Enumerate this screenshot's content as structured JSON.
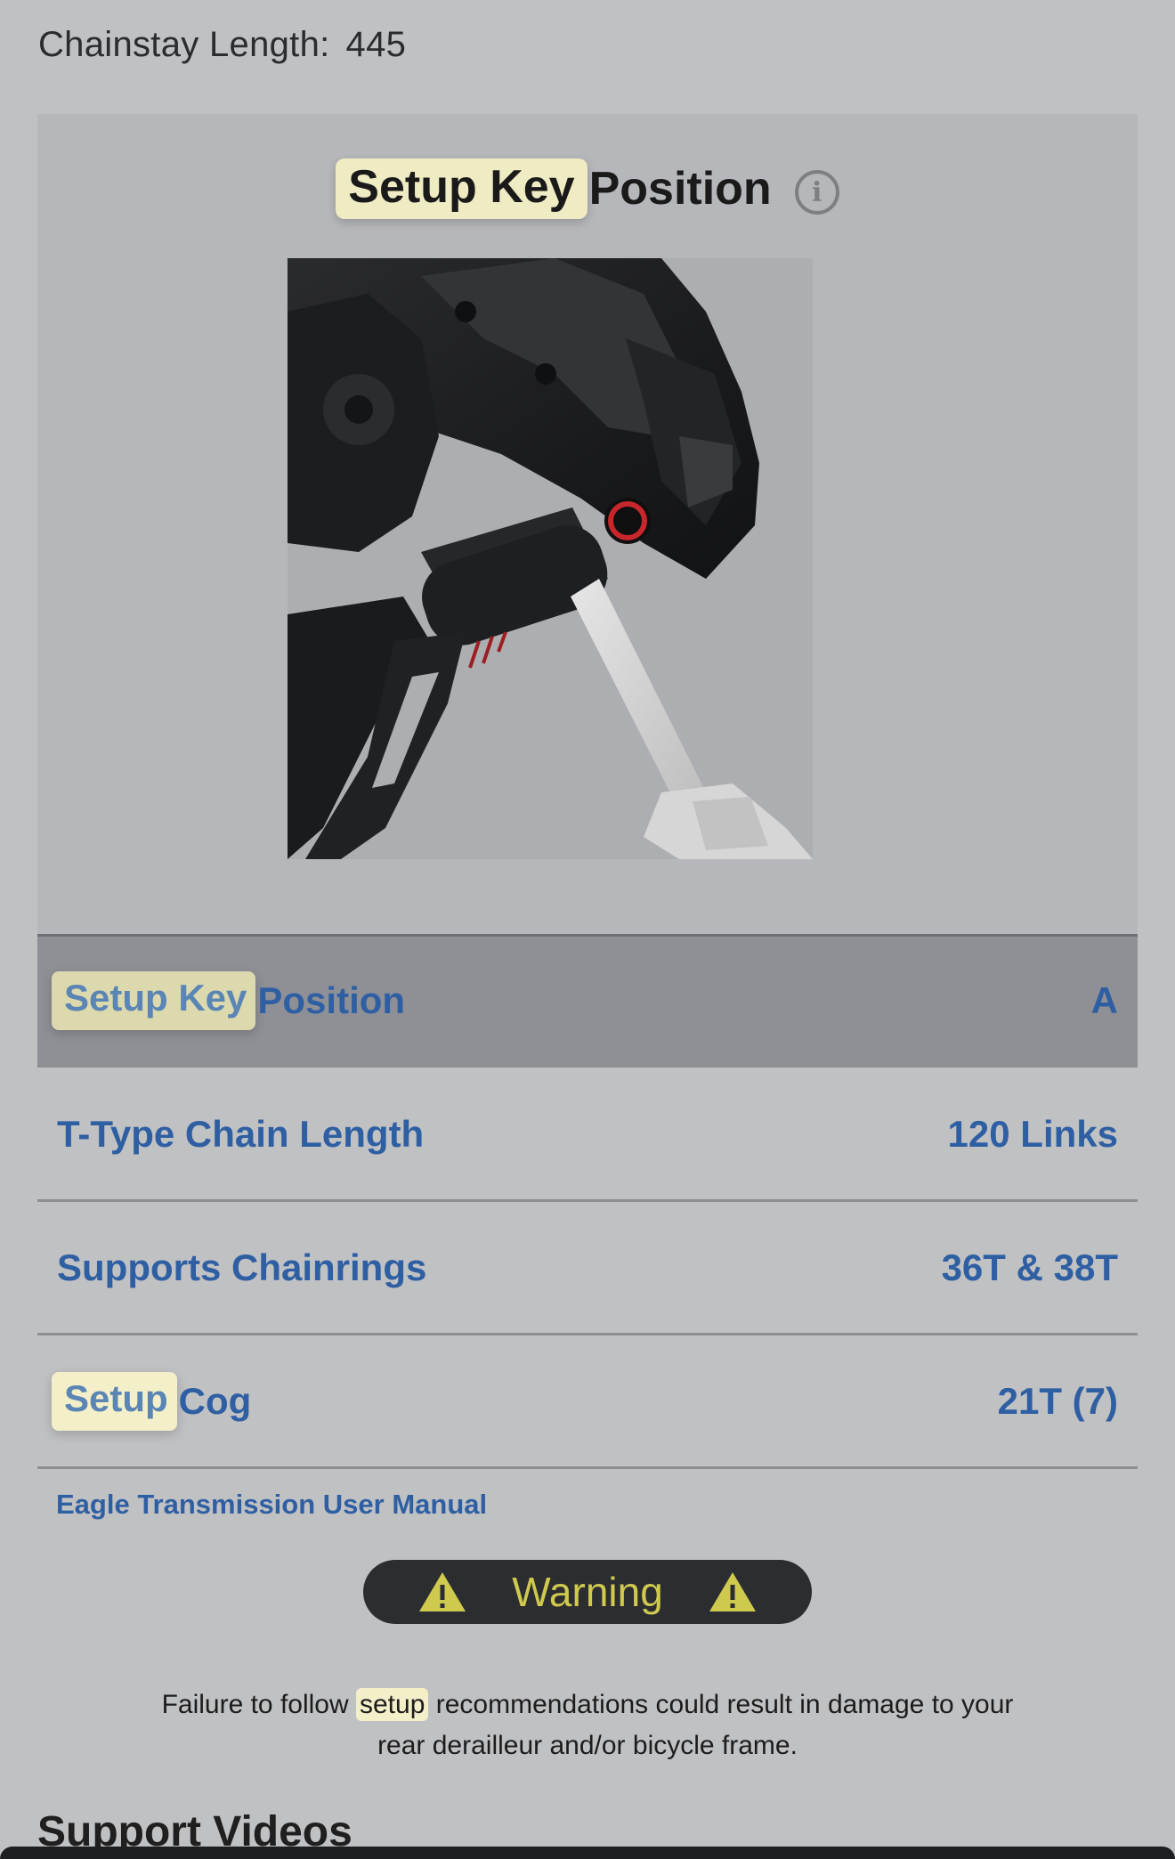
{
  "chainstay": {
    "label": "Chainstay Length:",
    "value": "445"
  },
  "hero": {
    "title_highlight": "Setup Key",
    "title_rest": "Position",
    "info_icon": "info-icon",
    "image_icon": "derailleur-setup-key-photo"
  },
  "rows": [
    {
      "label_highlight": "Setup Key",
      "label_rest": "Position",
      "value": "A"
    },
    {
      "label": "T-Type Chain Length",
      "value": "120 Links"
    },
    {
      "label": "Supports Chainrings",
      "value": "36T & 38T"
    },
    {
      "label_highlight": "Setup",
      "label_rest": "Cog",
      "value": "21T (7)"
    }
  ],
  "manual_link": "Eagle Transmission User Manual",
  "warning": {
    "label": "Warning",
    "icon": "warning-triangle-icon"
  },
  "disclaimer": {
    "before": "Failure to follow",
    "highlight": "setup",
    "after": "recommendations could result in damage to your rear derailleur and/or bicycle frame."
  },
  "support_videos_title": "Support Videos",
  "colors": {
    "link": "#2f5fa3",
    "highlight": "#efebc2",
    "warning_text": "#cfc94e",
    "warning_bg": "#2b2d31"
  }
}
